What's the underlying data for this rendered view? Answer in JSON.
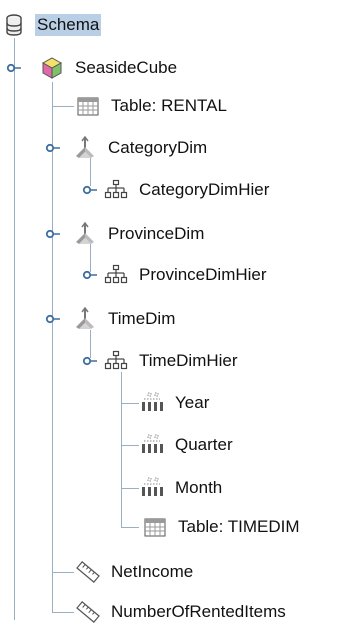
{
  "tree": {
    "root": {
      "label": "Schema",
      "icon": "database-icon"
    },
    "cube": {
      "label": "SeasideCube",
      "icon": "cube-icon"
    },
    "cube_table": {
      "label": "Table: RENTAL",
      "icon": "table-icon"
    },
    "dim_category": {
      "label": "CategoryDim",
      "icon": "dimension-icon"
    },
    "hier_category": {
      "label": "CategoryDimHier",
      "icon": "hierarchy-icon"
    },
    "dim_province": {
      "label": "ProvinceDim",
      "icon": "dimension-icon"
    },
    "hier_province": {
      "label": "ProvinceDimHier",
      "icon": "hierarchy-icon"
    },
    "dim_time": {
      "label": "TimeDim",
      "icon": "dimension-icon"
    },
    "hier_time": {
      "label": "TimeDimHier",
      "icon": "hierarchy-icon"
    },
    "level_year": {
      "label": "Year",
      "icon": "level-icon"
    },
    "level_quarter": {
      "label": "Quarter",
      "icon": "level-icon"
    },
    "level_month": {
      "label": "Month",
      "icon": "level-icon"
    },
    "time_table": {
      "label": "Table: TIMEDIM",
      "icon": "table-icon"
    },
    "measure_netincome": {
      "label": "NetIncome",
      "icon": "measure-icon"
    },
    "measure_rented": {
      "label": "NumberOfRentedItems",
      "icon": "measure-icon"
    }
  },
  "colors": {
    "selection": "#b8cfe5",
    "tree_line": "#9aaec4",
    "handle": "#3d6e9e"
  }
}
